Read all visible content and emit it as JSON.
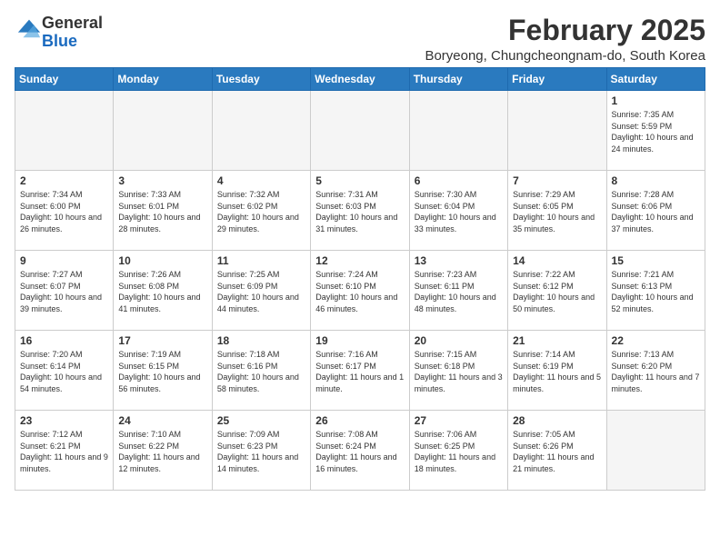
{
  "header": {
    "logo": {
      "general": "General",
      "blue": "Blue"
    },
    "month_title": "February 2025",
    "location": "Boryeong, Chungcheongnam-do, South Korea"
  },
  "calendar": {
    "days_of_week": [
      "Sunday",
      "Monday",
      "Tuesday",
      "Wednesday",
      "Thursday",
      "Friday",
      "Saturday"
    ],
    "weeks": [
      [
        {
          "day": "",
          "info": ""
        },
        {
          "day": "",
          "info": ""
        },
        {
          "day": "",
          "info": ""
        },
        {
          "day": "",
          "info": ""
        },
        {
          "day": "",
          "info": ""
        },
        {
          "day": "",
          "info": ""
        },
        {
          "day": "1",
          "info": "Sunrise: 7:35 AM\nSunset: 5:59 PM\nDaylight: 10 hours and 24 minutes."
        }
      ],
      [
        {
          "day": "2",
          "info": "Sunrise: 7:34 AM\nSunset: 6:00 PM\nDaylight: 10 hours and 26 minutes."
        },
        {
          "day": "3",
          "info": "Sunrise: 7:33 AM\nSunset: 6:01 PM\nDaylight: 10 hours and 28 minutes."
        },
        {
          "day": "4",
          "info": "Sunrise: 7:32 AM\nSunset: 6:02 PM\nDaylight: 10 hours and 29 minutes."
        },
        {
          "day": "5",
          "info": "Sunrise: 7:31 AM\nSunset: 6:03 PM\nDaylight: 10 hours and 31 minutes."
        },
        {
          "day": "6",
          "info": "Sunrise: 7:30 AM\nSunset: 6:04 PM\nDaylight: 10 hours and 33 minutes."
        },
        {
          "day": "7",
          "info": "Sunrise: 7:29 AM\nSunset: 6:05 PM\nDaylight: 10 hours and 35 minutes."
        },
        {
          "day": "8",
          "info": "Sunrise: 7:28 AM\nSunset: 6:06 PM\nDaylight: 10 hours and 37 minutes."
        }
      ],
      [
        {
          "day": "9",
          "info": "Sunrise: 7:27 AM\nSunset: 6:07 PM\nDaylight: 10 hours and 39 minutes."
        },
        {
          "day": "10",
          "info": "Sunrise: 7:26 AM\nSunset: 6:08 PM\nDaylight: 10 hours and 41 minutes."
        },
        {
          "day": "11",
          "info": "Sunrise: 7:25 AM\nSunset: 6:09 PM\nDaylight: 10 hours and 44 minutes."
        },
        {
          "day": "12",
          "info": "Sunrise: 7:24 AM\nSunset: 6:10 PM\nDaylight: 10 hours and 46 minutes."
        },
        {
          "day": "13",
          "info": "Sunrise: 7:23 AM\nSunset: 6:11 PM\nDaylight: 10 hours and 48 minutes."
        },
        {
          "day": "14",
          "info": "Sunrise: 7:22 AM\nSunset: 6:12 PM\nDaylight: 10 hours and 50 minutes."
        },
        {
          "day": "15",
          "info": "Sunrise: 7:21 AM\nSunset: 6:13 PM\nDaylight: 10 hours and 52 minutes."
        }
      ],
      [
        {
          "day": "16",
          "info": "Sunrise: 7:20 AM\nSunset: 6:14 PM\nDaylight: 10 hours and 54 minutes."
        },
        {
          "day": "17",
          "info": "Sunrise: 7:19 AM\nSunset: 6:15 PM\nDaylight: 10 hours and 56 minutes."
        },
        {
          "day": "18",
          "info": "Sunrise: 7:18 AM\nSunset: 6:16 PM\nDaylight: 10 hours and 58 minutes."
        },
        {
          "day": "19",
          "info": "Sunrise: 7:16 AM\nSunset: 6:17 PM\nDaylight: 11 hours and 1 minute."
        },
        {
          "day": "20",
          "info": "Sunrise: 7:15 AM\nSunset: 6:18 PM\nDaylight: 11 hours and 3 minutes."
        },
        {
          "day": "21",
          "info": "Sunrise: 7:14 AM\nSunset: 6:19 PM\nDaylight: 11 hours and 5 minutes."
        },
        {
          "day": "22",
          "info": "Sunrise: 7:13 AM\nSunset: 6:20 PM\nDaylight: 11 hours and 7 minutes."
        }
      ],
      [
        {
          "day": "23",
          "info": "Sunrise: 7:12 AM\nSunset: 6:21 PM\nDaylight: 11 hours and 9 minutes."
        },
        {
          "day": "24",
          "info": "Sunrise: 7:10 AM\nSunset: 6:22 PM\nDaylight: 11 hours and 12 minutes."
        },
        {
          "day": "25",
          "info": "Sunrise: 7:09 AM\nSunset: 6:23 PM\nDaylight: 11 hours and 14 minutes."
        },
        {
          "day": "26",
          "info": "Sunrise: 7:08 AM\nSunset: 6:24 PM\nDaylight: 11 hours and 16 minutes."
        },
        {
          "day": "27",
          "info": "Sunrise: 7:06 AM\nSunset: 6:25 PM\nDaylight: 11 hours and 18 minutes."
        },
        {
          "day": "28",
          "info": "Sunrise: 7:05 AM\nSunset: 6:26 PM\nDaylight: 11 hours and 21 minutes."
        },
        {
          "day": "",
          "info": ""
        }
      ]
    ]
  }
}
